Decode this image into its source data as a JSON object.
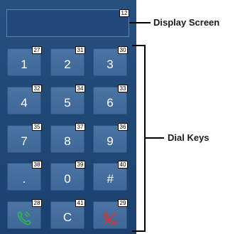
{
  "display": {
    "badge": "12"
  },
  "keys": [
    {
      "label": "1",
      "badge": "27"
    },
    {
      "label": "2",
      "badge": "31"
    },
    {
      "label": "3",
      "badge": "30"
    },
    {
      "label": "4",
      "badge": "32"
    },
    {
      "label": "5",
      "badge": "34"
    },
    {
      "label": "6",
      "badge": "33"
    },
    {
      "label": "7",
      "badge": "35"
    },
    {
      "label": "8",
      "badge": "37"
    },
    {
      "label": "9",
      "badge": "36"
    },
    {
      "label": ".",
      "badge": "38"
    },
    {
      "label": "0",
      "badge": "39"
    },
    {
      "label": "#",
      "badge": "40"
    },
    {
      "icon": "call-icon",
      "badge": "28"
    },
    {
      "label": "C",
      "badge": "41"
    },
    {
      "icon": "hangup-icon",
      "badge": "29"
    }
  ],
  "callouts": {
    "display_screen": "Display Screen",
    "dial_keys": "Dial Keys"
  },
  "colors": {
    "panel": "#1f4774",
    "key": "#45709e",
    "call_green": "#2db84a",
    "hangup_red": "#e03030"
  }
}
